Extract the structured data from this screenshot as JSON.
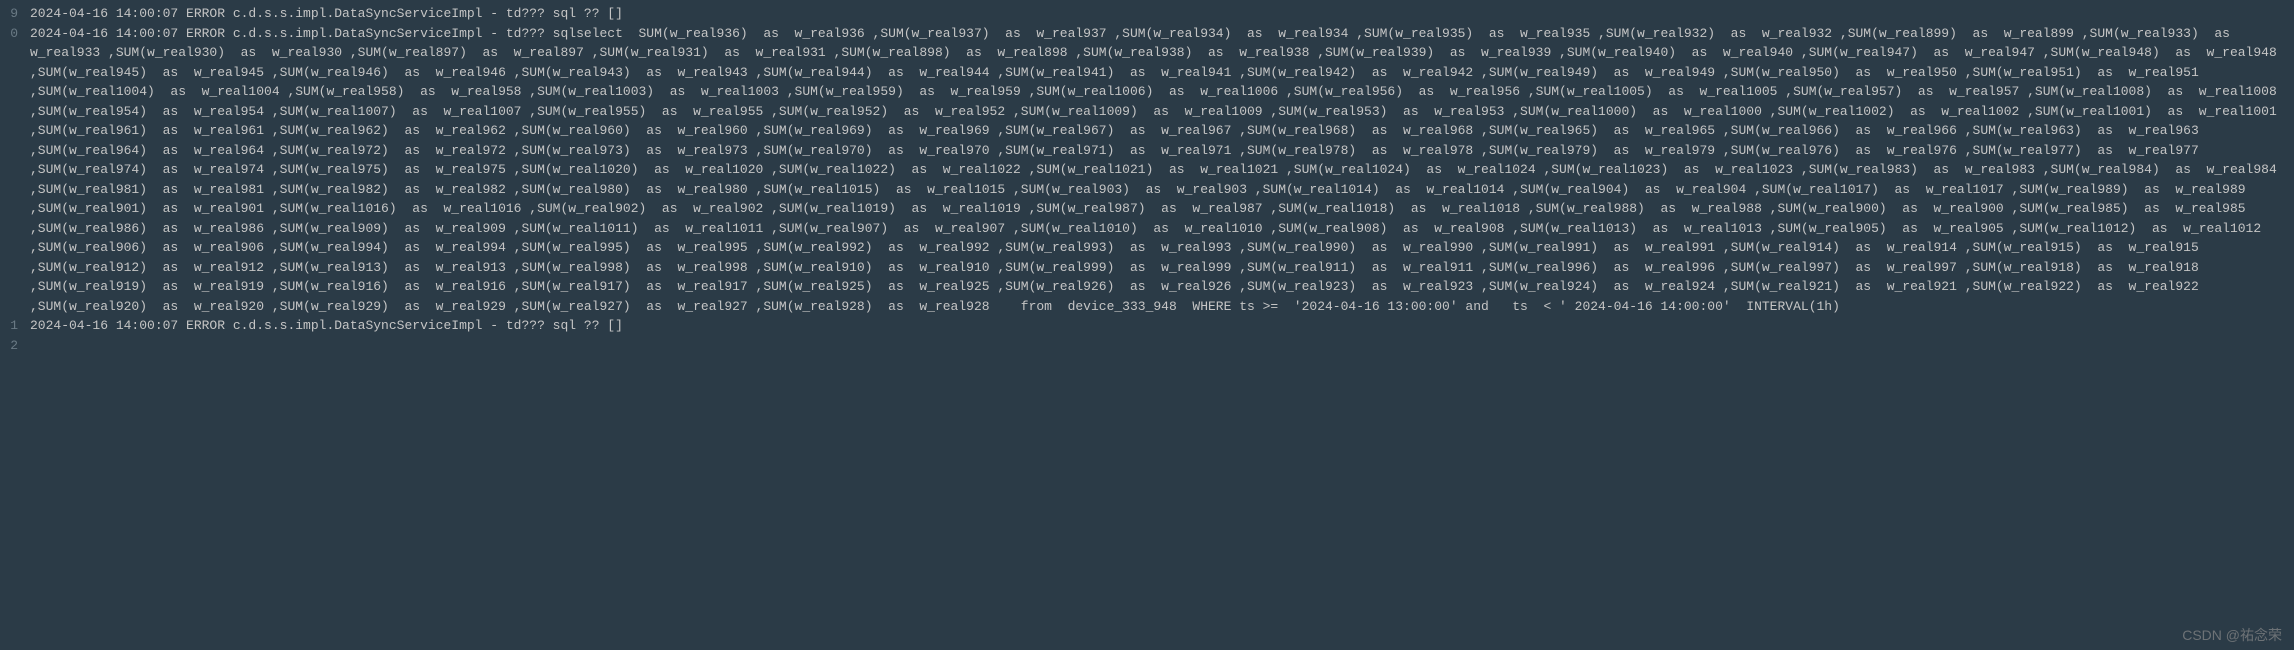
{
  "gutter": [
    "9",
    "0",
    "1",
    "2"
  ],
  "lines": [
    "2024-04-16 14:00:07 ERROR c.d.s.s.impl.DataSyncServiceImpl - td??? sql ?? []",
    "2024-04-16 14:00:07 ERROR c.d.s.s.impl.DataSyncServiceImpl - td??? sqlselect  SUM(w_real936)  as  w_real936 ,SUM(w_real937)  as  w_real937 ,SUM(w_real934)  as  w_real934 ,SUM(w_real935)  as  w_real935 ,SUM(w_real932)  as  w_real932 ,SUM(w_real899)  as  w_real899 ,SUM(w_real933)  as  w_real933 ,SUM(w_real930)  as  w_real930 ,SUM(w_real897)  as  w_real897 ,SUM(w_real931)  as  w_real931 ,SUM(w_real898)  as  w_real898 ,SUM(w_real938)  as  w_real938 ,SUM(w_real939)  as  w_real939 ,SUM(w_real940)  as  w_real940 ,SUM(w_real947)  as  w_real947 ,SUM(w_real948)  as  w_real948 ,SUM(w_real945)  as  w_real945 ,SUM(w_real946)  as  w_real946 ,SUM(w_real943)  as  w_real943 ,SUM(w_real944)  as  w_real944 ,SUM(w_real941)  as  w_real941 ,SUM(w_real942)  as  w_real942 ,SUM(w_real949)  as  w_real949 ,SUM(w_real950)  as  w_real950 ,SUM(w_real951)  as  w_real951 ,SUM(w_real1004)  as  w_real1004 ,SUM(w_real958)  as  w_real958 ,SUM(w_real1003)  as  w_real1003 ,SUM(w_real959)  as  w_real959 ,SUM(w_real1006)  as  w_real1006 ,SUM(w_real956)  as  w_real956 ,SUM(w_real1005)  as  w_real1005 ,SUM(w_real957)  as  w_real957 ,SUM(w_real1008)  as  w_real1008 ,SUM(w_real954)  as  w_real954 ,SUM(w_real1007)  as  w_real1007 ,SUM(w_real955)  as  w_real955 ,SUM(w_real952)  as  w_real952 ,SUM(w_real1009)  as  w_real1009 ,SUM(w_real953)  as  w_real953 ,SUM(w_real1000)  as  w_real1000 ,SUM(w_real1002)  as  w_real1002 ,SUM(w_real1001)  as  w_real1001 ,SUM(w_real961)  as  w_real961 ,SUM(w_real962)  as  w_real962 ,SUM(w_real960)  as  w_real960 ,SUM(w_real969)  as  w_real969 ,SUM(w_real967)  as  w_real967 ,SUM(w_real968)  as  w_real968 ,SUM(w_real965)  as  w_real965 ,SUM(w_real966)  as  w_real966 ,SUM(w_real963)  as  w_real963 ,SUM(w_real964)  as  w_real964 ,SUM(w_real972)  as  w_real972 ,SUM(w_real973)  as  w_real973 ,SUM(w_real970)  as  w_real970 ,SUM(w_real971)  as  w_real971 ,SUM(w_real978)  as  w_real978 ,SUM(w_real979)  as  w_real979 ,SUM(w_real976)  as  w_real976 ,SUM(w_real977)  as  w_real977 ,SUM(w_real974)  as  w_real974 ,SUM(w_real975)  as  w_real975 ,SUM(w_real1020)  as  w_real1020 ,SUM(w_real1022)  as  w_real1022 ,SUM(w_real1021)  as  w_real1021 ,SUM(w_real1024)  as  w_real1024 ,SUM(w_real1023)  as  w_real1023 ,SUM(w_real983)  as  w_real983 ,SUM(w_real984)  as  w_real984 ,SUM(w_real981)  as  w_real981 ,SUM(w_real982)  as  w_real982 ,SUM(w_real980)  as  w_real980 ,SUM(w_real1015)  as  w_real1015 ,SUM(w_real903)  as  w_real903 ,SUM(w_real1014)  as  w_real1014 ,SUM(w_real904)  as  w_real904 ,SUM(w_real1017)  as  w_real1017 ,SUM(w_real989)  as  w_real989 ,SUM(w_real901)  as  w_real901 ,SUM(w_real1016)  as  w_real1016 ,SUM(w_real902)  as  w_real902 ,SUM(w_real1019)  as  w_real1019 ,SUM(w_real987)  as  w_real987 ,SUM(w_real1018)  as  w_real1018 ,SUM(w_real988)  as  w_real988 ,SUM(w_real900)  as  w_real900 ,SUM(w_real985)  as  w_real985 ,SUM(w_real986)  as  w_real986 ,SUM(w_real909)  as  w_real909 ,SUM(w_real1011)  as  w_real1011 ,SUM(w_real907)  as  w_real907 ,SUM(w_real1010)  as  w_real1010 ,SUM(w_real908)  as  w_real908 ,SUM(w_real1013)  as  w_real1013 ,SUM(w_real905)  as  w_real905 ,SUM(w_real1012)  as  w_real1012 ,SUM(w_real906)  as  w_real906 ,SUM(w_real994)  as  w_real994 ,SUM(w_real995)  as  w_real995 ,SUM(w_real992)  as  w_real992 ,SUM(w_real993)  as  w_real993 ,SUM(w_real990)  as  w_real990 ,SUM(w_real991)  as  w_real991 ,SUM(w_real914)  as  w_real914 ,SUM(w_real915)  as  w_real915 ,SUM(w_real912)  as  w_real912 ,SUM(w_real913)  as  w_real913 ,SUM(w_real998)  as  w_real998 ,SUM(w_real910)  as  w_real910 ,SUM(w_real999)  as  w_real999 ,SUM(w_real911)  as  w_real911 ,SUM(w_real996)  as  w_real996 ,SUM(w_real997)  as  w_real997 ,SUM(w_real918)  as  w_real918 ,SUM(w_real919)  as  w_real919 ,SUM(w_real916)  as  w_real916 ,SUM(w_real917)  as  w_real917 ,SUM(w_real925)  as  w_real925 ,SUM(w_real926)  as  w_real926 ,SUM(w_real923)  as  w_real923 ,SUM(w_real924)  as  w_real924 ,SUM(w_real921)  as  w_real921 ,SUM(w_real922)  as  w_real922 ,SUM(w_real920)  as  w_real920 ,SUM(w_real929)  as  w_real929 ,SUM(w_real927)  as  w_real927 ,SUM(w_real928)  as  w_real928    from  device_333_948  WHERE ts >=  '2024-04-16 13:00:00' and   ts  < ' 2024-04-16 14:00:00'  INTERVAL(1h)",
    "2024-04-16 14:00:07 ERROR c.d.s.s.impl.DataSyncServiceImpl - td??? sql ?? []",
    ""
  ],
  "watermark": "CSDN @祐念荣"
}
